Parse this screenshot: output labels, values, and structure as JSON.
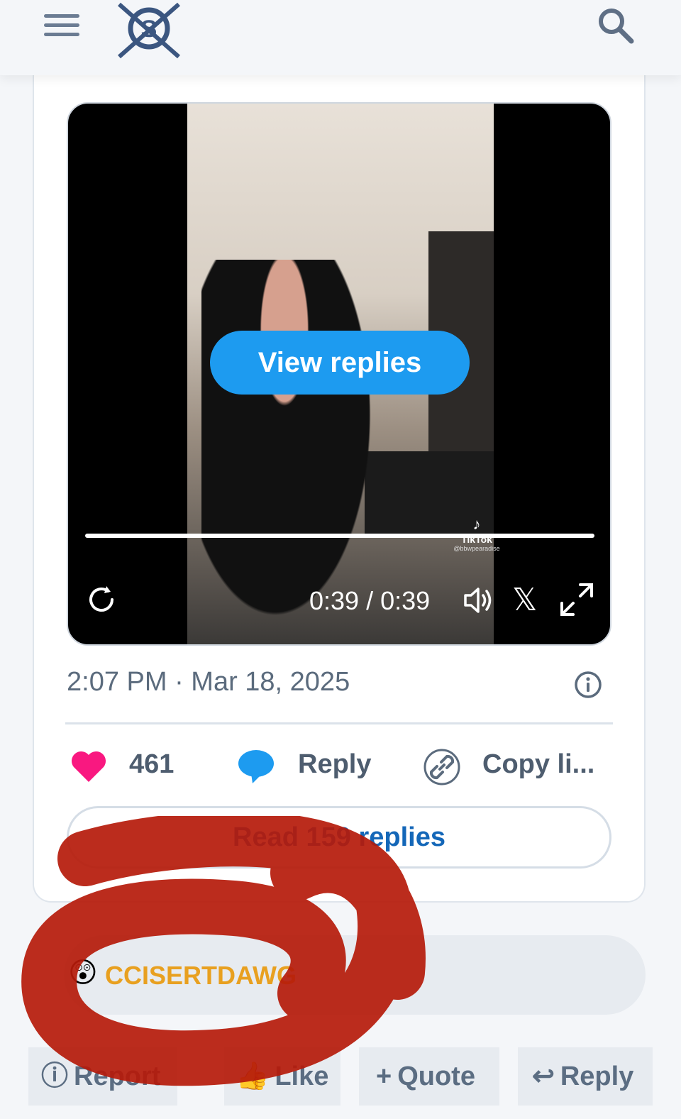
{
  "header": {
    "menu_icon": "hamburger-menu-icon",
    "logo_icon": "site-logo-icon",
    "search_icon": "search-icon"
  },
  "video": {
    "overlay_button": "View replies",
    "time": "0:39 / 0:39",
    "watermark_name": "TikTok",
    "watermark_handle": "@bbwpearadise",
    "progress_fraction": 1.0
  },
  "post": {
    "timestamp": "2:07 PM · Mar 18, 2025",
    "likes": "461",
    "reply_label": "Reply",
    "copy_label": "Copy li...",
    "read_replies": "Read 159 replies"
  },
  "user": {
    "emoji": "😲",
    "name": "CCISERTDAWG"
  },
  "footer": {
    "report": "Report",
    "like": "Like",
    "quote": "Quote",
    "reply": "Reply"
  },
  "colors": {
    "accent": "#1d9bf0",
    "heart": "#f91880",
    "username": "#e8a020",
    "scribble": "#b51a0a"
  }
}
